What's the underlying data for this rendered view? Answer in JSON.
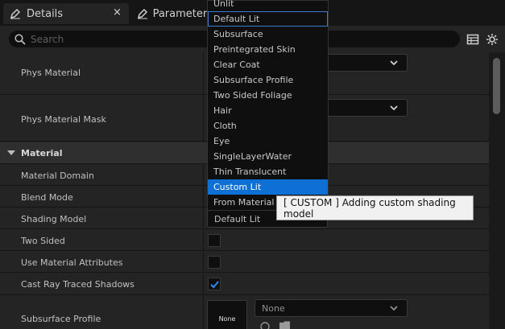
{
  "tabs": [
    {
      "label": "Details",
      "icon": "pencil-icon",
      "active": true
    },
    {
      "label": "Parameters",
      "icon": "pencil-icon",
      "active": false
    }
  ],
  "tab_close_glyph": "×",
  "search": {
    "placeholder": "Search",
    "value": ""
  },
  "toolbar_icons": [
    "table-icon",
    "gear-icon"
  ],
  "sections": {
    "physics_rows": [
      {
        "label": "Phys Material"
      },
      {
        "label": "Phys Material Mask"
      }
    ],
    "material_category": "Material",
    "material_rows": [
      {
        "label": "Material Domain"
      },
      {
        "label": "Blend Mode"
      },
      {
        "label": "Shading Model",
        "value": "Default Lit"
      },
      {
        "label": "Two Sided",
        "checked": false
      },
      {
        "label": "Use Material Attributes",
        "checked": false
      },
      {
        "label": "Cast Ray Traced Shadows",
        "checked": true
      },
      {
        "label": "Subsurface Profile",
        "value": "None",
        "thumbnail": "None"
      }
    ]
  },
  "dropdown": {
    "items": [
      "Unlit",
      "Default Lit",
      "Subsurface",
      "Preintegrated Skin",
      "Clear Coat",
      "Subsurface Profile",
      "Two Sided Foliage",
      "Hair",
      "Cloth",
      "Eye",
      "SingleLayerWater",
      "Thin Translucent",
      "Custom Lit",
      "From Material"
    ],
    "selected": "Default Lit",
    "highlighted": "Custom Lit"
  },
  "tooltip": "[ CUSTOM ] Adding custom shading model",
  "colors": {
    "highlight": "#0E70D4",
    "panel_bg": "#242424",
    "check": "#2E8BF0"
  }
}
